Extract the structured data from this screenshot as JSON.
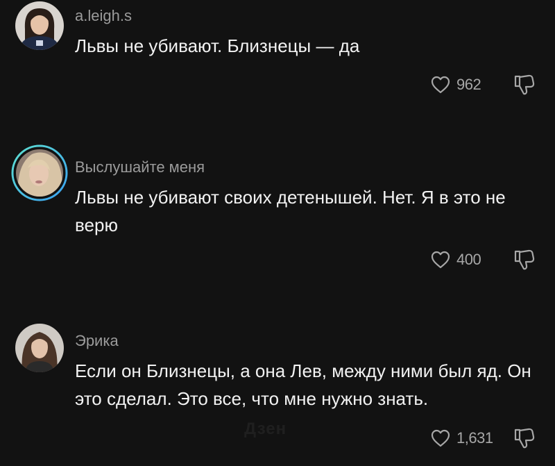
{
  "comments": [
    {
      "username": "a.leigh.s",
      "text": "Львы не убивают. Близнецы — да",
      "likes": "962",
      "avatar": "woman-dark-hair-icon"
    },
    {
      "username": "Выслушайте меня",
      "text": "Львы не убивают своих детенышей. Нет. Я в это не верю",
      "likes": "400",
      "avatar": "woman-blonde-hair-story-ring-icon"
    },
    {
      "username": "Эрика",
      "text": "Если он Близнецы, а она Лев, между ними был яд. Он это сделал. Это все, что мне нужно знать.",
      "likes": "1,631",
      "avatar": "woman-curly-hair-icon"
    }
  ],
  "watermark": "Дзен",
  "colors": {
    "background": "#121212",
    "username": "#9b9b9b",
    "text": "#f2f2f2",
    "icon": "#a7a7a7",
    "story_ring_start": "#5ee0d0",
    "story_ring_end": "#3aa0f0"
  }
}
